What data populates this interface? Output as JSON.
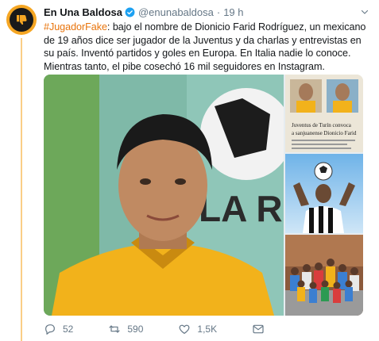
{
  "author": {
    "display_name": "En Una Baldosa",
    "handle": "@enunabaldosa",
    "separator": "·",
    "time": "19 h",
    "verified_icon": "verified-badge-icon",
    "avatar_icon": "thumbs-down-icon",
    "brand_color": "#f5a623"
  },
  "tweet": {
    "hashtag": "#JugadorFake",
    "body": ": bajo el nombre de Dionicio Farid Rodríguez, un mexicano de 19 años dice ser jugador de la Juventus y da charlas y entrevistas en su país. Inventó partidos y goles en Europa. En Italia nadie lo conoce. Mientras tanto, el pibe cosechó 16 mil seguidores en Instagram.",
    "hashtag_color": "#e8740c"
  },
  "media": {
    "main_wall_text": "LA RI",
    "clipping_headline_1": "Juventus de Turín convoca",
    "clipping_headline_2": "a sanjuanense Dionicio Farid"
  },
  "actions": {
    "reply_count": "52",
    "retweet_count": "590",
    "like_count": "1,5K",
    "icons": [
      "reply-icon",
      "retweet-icon",
      "like-icon",
      "message-icon"
    ]
  }
}
